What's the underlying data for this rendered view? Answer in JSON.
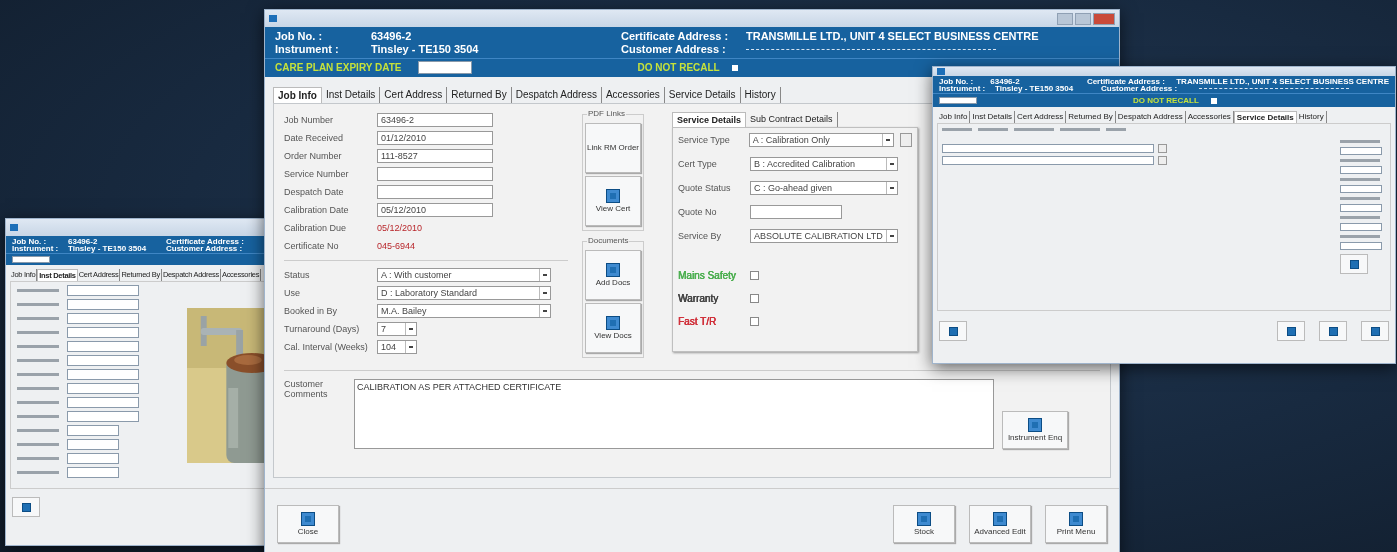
{
  "left_window": {
    "header": {
      "job_no_label": "Job No. :",
      "job_no": "63496-2",
      "instrument_label": "Instrument :",
      "instrument": "Tinsley - TE150 3504",
      "cert_address_label": "Certificate Address :",
      "customer_address_label": "Customer Address :"
    },
    "tabs": [
      {
        "label": "Job Info",
        "selected": false
      },
      {
        "label": "Inst Details",
        "selected": true
      },
      {
        "label": "Cert Address",
        "selected": false
      },
      {
        "label": "Returned By",
        "selected": false
      },
      {
        "label": "Despatch Address",
        "selected": false
      },
      {
        "label": "Accessories",
        "selected": false
      }
    ]
  },
  "main_window": {
    "header": {
      "job_no_label": "Job No. :",
      "job_no": "63496-2",
      "instrument_label": "Instrument :",
      "instrument": "Tinsley - TE150 3504",
      "cert_address_label": "Certificate Address :",
      "cert_address": "TRANSMILLE LTD., UNIT 4 SELECT BUSINESS CENTRE",
      "customer_address_label": "Customer Address :"
    },
    "care_plan": {
      "label": "CARE PLAN EXPIRY DATE"
    },
    "do_not_recall": {
      "label": "DO NOT RECALL",
      "checked": false
    },
    "tabs": [
      {
        "label": "Job Info",
        "selected": true
      },
      {
        "label": "Inst Details",
        "selected": false
      },
      {
        "label": "Cert Address",
        "selected": false
      },
      {
        "label": "Returned By",
        "selected": false
      },
      {
        "label": "Despatch Address",
        "selected": false
      },
      {
        "label": "Accessories",
        "selected": false
      },
      {
        "label": "Service Details",
        "selected": false
      },
      {
        "label": "History",
        "selected": false
      }
    ],
    "fields": [
      {
        "label": "Job Number",
        "kind": "input",
        "value": "63496-2"
      },
      {
        "label": "Date Received",
        "kind": "input",
        "value": "01/12/2010"
      },
      {
        "label": "Order Number",
        "kind": "input",
        "value": "111-8527"
      },
      {
        "label": "Service Number",
        "kind": "input"
      },
      {
        "label": "Despatch Date",
        "kind": "input"
      },
      {
        "label": "Calibration Date",
        "kind": "input",
        "value": "05/12/2010"
      },
      {
        "label": "Calibration Due",
        "kind": "text",
        "value": "05/12/2010"
      },
      {
        "label": "Certificate No",
        "kind": "text",
        "value": "045-6944"
      }
    ],
    "selects": [
      {
        "label": "Status",
        "value": "A : With customer",
        "kind": "wide"
      },
      {
        "label": "Use",
        "value": "D : Laboratory Standard",
        "kind": "wide"
      },
      {
        "label": "Booked in By",
        "value": "M.A. Bailey",
        "kind": "wide"
      },
      {
        "label": "Turnaround (Days)",
        "value": "7",
        "kind": "narrow"
      },
      {
        "label": "Cal. Interval (Weeks)",
        "value": "104",
        "kind": "narrow"
      }
    ],
    "pdf_links": {
      "title": "PDF Links",
      "buttons": [
        {
          "label": "Link RM Order",
          "kind": "text"
        },
        {
          "label": "View Cert",
          "kind": "icon"
        }
      ]
    },
    "documents": {
      "title": "Documents",
      "buttons": [
        {
          "label": "Add Docs",
          "kind": "icon"
        },
        {
          "label": "View Docs",
          "kind": "icon"
        }
      ]
    },
    "service_tabs": [
      {
        "label": "Service Details",
        "selected": true
      },
      {
        "label": "Sub Contract Details",
        "selected": false
      }
    ],
    "service_fields": [
      {
        "label": "Service Type",
        "kind": "select_button",
        "value": "A : Calibration Only"
      },
      {
        "label": "Cert Type",
        "kind": "select",
        "value": "B : Accredited Calibration"
      },
      {
        "label": "Quote Status",
        "kind": "select",
        "value": "C : Go-ahead given"
      },
      {
        "label": "Quote No",
        "kind": "input"
      },
      {
        "label": "Service By",
        "kind": "select",
        "value": "ABSOLUTE CALIBRATION LTD"
      }
    ],
    "service_checks": [
      {
        "label": "Mains Safety",
        "checked": false,
        "color": "#4caf50"
      },
      {
        "label": "Warranty",
        "checked": false,
        "color": "#444444"
      },
      {
        "label": "Fast T/R",
        "checked": false,
        "color": "#d0303a"
      }
    ],
    "comments": {
      "label": "Customer Comments",
      "value": "CALIBRATION AS PER ATTACHED CERTIFICATE"
    },
    "instrument_enq": "Instrument Enq",
    "close_button": "Close",
    "action_buttons": [
      "Stock",
      "Advanced Edit",
      "Print Menu"
    ]
  },
  "right_window": {
    "header": {
      "job_no_label": "Job No. :",
      "job_no": "63496-2",
      "instrument_label": "Instrument :",
      "instrument": "Tinsley - TE150 3504",
      "cert_address_label": "Certificate Address :",
      "cert_address": "TRANSMILLE LTD., UNIT 4 SELECT BUSINESS CENTRE",
      "customer_address_label": "Customer Address :"
    },
    "do_not_recall": {
      "label": "DO NOT RECALL",
      "checked": false
    },
    "tabs": [
      {
        "label": "Job Info",
        "selected": false
      },
      {
        "label": "Inst Details",
        "selected": false
      },
      {
        "label": "Cert Address",
        "selected": false
      },
      {
        "label": "Returned By",
        "selected": false
      },
      {
        "label": "Despatch Address",
        "selected": false
      },
      {
        "label": "Accessories",
        "selected": false
      },
      {
        "label": "Service Details",
        "selected": true
      },
      {
        "label": "History",
        "selected": false
      }
    ]
  }
}
